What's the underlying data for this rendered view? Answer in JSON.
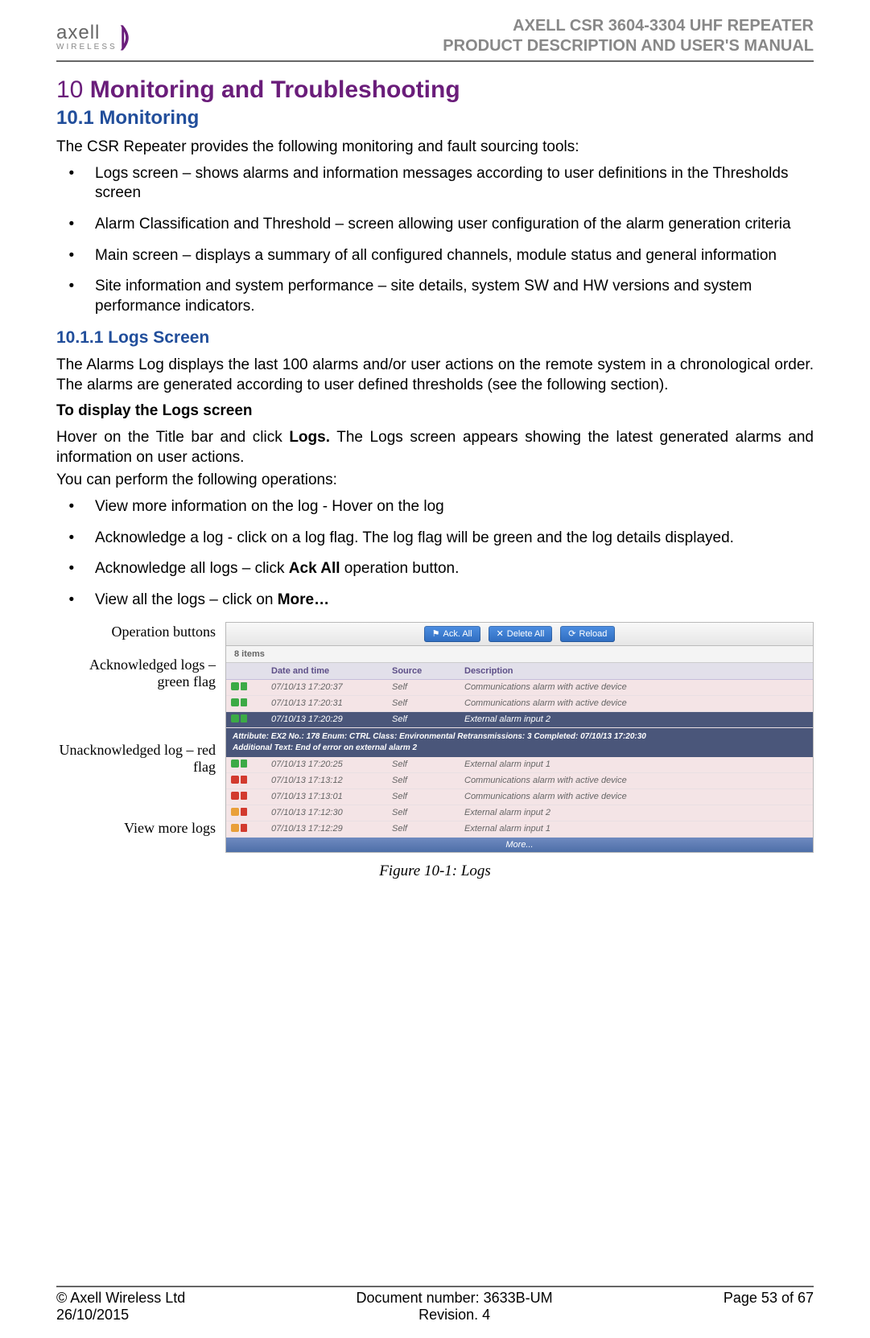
{
  "header": {
    "brand": "axell",
    "brand_sub": "WIRELESS",
    "title1": "AXELL CSR 3604-3304 UHF REPEATER",
    "title2": "PRODUCT DESCRIPTION AND USER'S MANUAL"
  },
  "chapter": {
    "num": "10",
    "title": "Monitoring and Troubleshooting"
  },
  "section": "10.1 Monitoring",
  "intro": "The CSR Repeater provides the following monitoring and fault sourcing tools:",
  "intro_list": [
    "Logs screen – shows alarms and information messages according to user definitions in the Thresholds screen",
    "Alarm Classification and Threshold – screen allowing user configuration of the alarm generation criteria",
    "Main screen – displays a summary of all configured channels, module status and general information",
    "Site information and system performance – site details, system SW and HW versions and system performance indicators."
  ],
  "subsection": "10.1.1   Logs Screen",
  "logs_para": "The Alarms Log displays the last 100 alarms and/or user actions on the remote system in a chronological order. The alarms are generated according to user defined thresholds (see the following section).",
  "to_display": "To display the Logs screen",
  "hover_pre": "Hover on the Title bar and click ",
  "hover_bold": "Logs.",
  "hover_post": " The Logs screen appears showing the latest generated alarms and information on user actions.",
  "ops_intro": "You can perform the following operations:",
  "ops_list": [
    "View more information on the log - Hover on the log",
    "Acknowledge a log - click on a log flag. The log flag will be green and the log details displayed.",
    "Acknowledge all logs – click Ack All operation button.",
    "View all the logs – click on More…"
  ],
  "ops_bold": {
    "2": "Ack All",
    "3": "More…"
  },
  "callouts": {
    "op": "Operation buttons",
    "ack": "Acknowledged logs – green flag",
    "unack": "Unacknowledged log – red flag",
    "more": "View more logs"
  },
  "screenshot": {
    "buttons": {
      "ack": "Ack. All",
      "del": "Delete All",
      "reload": "Reload"
    },
    "count": "8 items",
    "headers": {
      "dt": "Date and time",
      "src": "Source",
      "desc": "Description"
    },
    "rows": [
      {
        "flag": "grn",
        "sev": "ok",
        "dt": "07/10/13 17:20:37",
        "src": "Self",
        "desc": "Communications alarm with active device",
        "pink": true
      },
      {
        "flag": "grn",
        "sev": "ok",
        "dt": "07/10/13 17:20:31",
        "src": "Self",
        "desc": "Communications alarm with active device",
        "pink": true
      },
      {
        "flag": "grn",
        "sev": "ok",
        "dt": "07/10/13 17:20:29",
        "src": "Self",
        "desc": "External alarm input 2",
        "sel": true
      },
      {
        "flag": "grn",
        "sev": "ok",
        "dt": "07/10/13 17:20:25",
        "src": "Self",
        "desc": "External alarm input 1",
        "pink": true
      },
      {
        "flag": "red",
        "sev": "err",
        "dt": "07/10/13 17:13:12",
        "src": "Self",
        "desc": "Communications alarm with active device",
        "pink": true
      },
      {
        "flag": "red",
        "sev": "err",
        "dt": "07/10/13 17:13:01",
        "src": "Self",
        "desc": "Communications alarm with active device",
        "pink": true
      },
      {
        "flag": "red",
        "sev": "warn",
        "dt": "07/10/13 17:12:30",
        "src": "Self",
        "desc": "External alarm input 2",
        "pink": true
      },
      {
        "flag": "red",
        "sev": "warn",
        "dt": "07/10/13 17:12:29",
        "src": "Self",
        "desc": "External alarm input 1",
        "pink": true
      }
    ],
    "details_l1": "Attribute: EX2    No.: 178    Enum: CTRL    Class: Environmental    Retransmissions: 3    Completed: 07/10/13 17:20:30",
    "details_l2": "Additional Text: End of error on external alarm 2",
    "more": "More..."
  },
  "fig_caption": "Figure 10-1:  Logs",
  "footer": {
    "left1": "© Axell Wireless Ltd",
    "left2": "26/10/2015",
    "center1": "Document number: 3633B-UM",
    "center2": "Revision. 4",
    "right": "Page 53 of 67"
  }
}
